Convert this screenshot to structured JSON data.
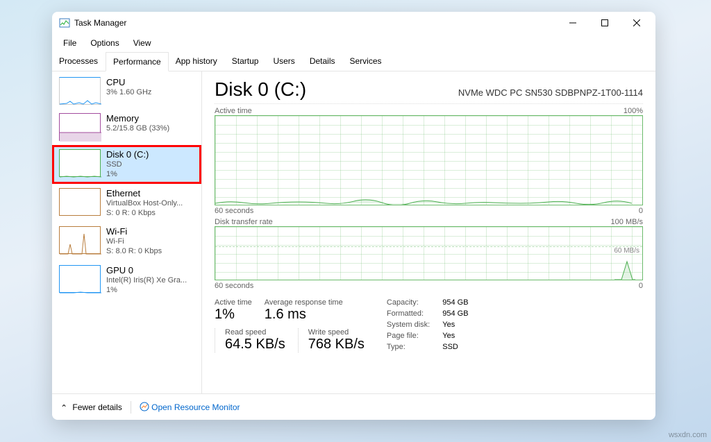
{
  "window": {
    "title": "Task Manager"
  },
  "menu": {
    "file": "File",
    "options": "Options",
    "view": "View"
  },
  "tabs": {
    "processes": "Processes",
    "performance": "Performance",
    "app_history": "App history",
    "startup": "Startup",
    "users": "Users",
    "details": "Details",
    "services": "Services"
  },
  "sidebar": {
    "cpu": {
      "title": "CPU",
      "sub": "3% 1.60 GHz"
    },
    "memory": {
      "title": "Memory",
      "sub": "5.2/15.8 GB (33%)"
    },
    "disk": {
      "title": "Disk 0 (C:)",
      "sub1": "SSD",
      "sub2": "1%"
    },
    "ethernet": {
      "title": "Ethernet",
      "sub1": "VirtualBox Host-Only...",
      "sub2": "S: 0 R: 0 Kbps"
    },
    "wifi": {
      "title": "Wi-Fi",
      "sub1": "Wi-Fi",
      "sub2": "S: 8.0 R: 0 Kbps"
    },
    "gpu": {
      "title": "GPU 0",
      "sub1": "Intel(R) Iris(R) Xe Gra...",
      "sub2": "1%"
    }
  },
  "main": {
    "heading": "Disk 0 (C:)",
    "model": "NVMe WDC PC SN530 SDBPNPZ-1T00-1114",
    "chart1": {
      "label_left": "Active time",
      "label_right": "100%",
      "x_left": "60 seconds",
      "x_right": "0"
    },
    "chart2": {
      "label_left": "Disk transfer rate",
      "label_right": "100 MB/s",
      "line60": "60 MB/s",
      "x_left": "60 seconds",
      "x_right": "0"
    },
    "stats": {
      "active_time": {
        "label": "Active time",
        "value": "1%"
      },
      "avg_response": {
        "label": "Average response time",
        "value": "1.6 ms"
      },
      "read_speed": {
        "label": "Read speed",
        "value": "64.5 KB/s"
      },
      "write_speed": {
        "label": "Write speed",
        "value": "768 KB/s"
      }
    },
    "info": {
      "capacity_l": "Capacity:",
      "capacity_v": "954 GB",
      "formatted_l": "Formatted:",
      "formatted_v": "954 GB",
      "system_l": "System disk:",
      "system_v": "Yes",
      "pagefile_l": "Page file:",
      "pagefile_v": "Yes",
      "type_l": "Type:",
      "type_v": "SSD"
    }
  },
  "footer": {
    "fewer": "Fewer details",
    "resmon": "Open Resource Monitor"
  },
  "watermark": "wsxdn.com",
  "chart_data": [
    {
      "type": "line",
      "title": "Active time",
      "xlabel": "seconds",
      "ylabel": "%",
      "xlim": [
        0,
        60
      ],
      "ylim": [
        0,
        100
      ],
      "x": [
        0,
        5,
        10,
        15,
        20,
        25,
        30,
        35,
        40,
        45,
        50,
        55,
        60
      ],
      "values": [
        1,
        2,
        3,
        2,
        4,
        3,
        5,
        4,
        3,
        4,
        3,
        2,
        1
      ]
    },
    {
      "type": "line",
      "title": "Disk transfer rate",
      "xlabel": "seconds",
      "ylabel": "MB/s",
      "xlim": [
        0,
        60
      ],
      "ylim": [
        0,
        100
      ],
      "annotations": [
        "60 MB/s"
      ],
      "series": [
        {
          "name": "Read",
          "x": [
            0,
            5,
            10,
            15,
            20,
            25,
            30,
            35,
            40,
            45,
            50,
            55,
            60
          ],
          "values": [
            0,
            0,
            0,
            0,
            0,
            0,
            0,
            0,
            0,
            0,
            0,
            0,
            0
          ]
        },
        {
          "name": "Write",
          "x": [
            0,
            5,
            10,
            15,
            20,
            25,
            30,
            35,
            40,
            45,
            50,
            55,
            58,
            60
          ],
          "values": [
            0,
            0,
            0,
            0,
            0,
            0,
            0,
            0,
            0,
            0,
            0,
            0,
            30,
            0
          ]
        }
      ]
    }
  ]
}
